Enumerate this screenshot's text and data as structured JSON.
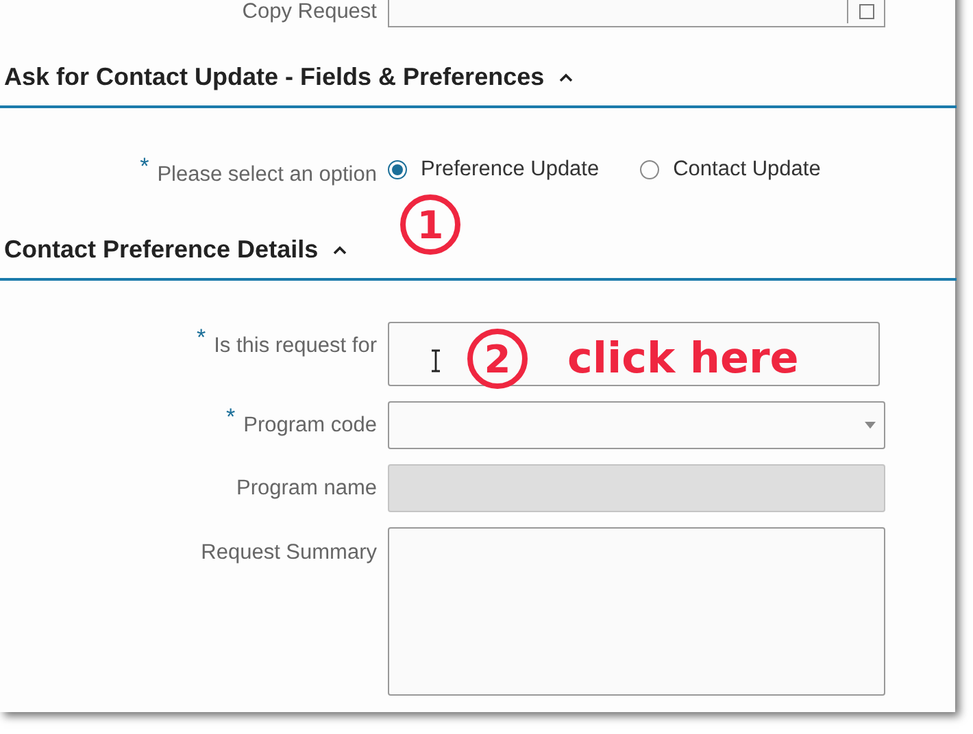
{
  "top_field": {
    "label": "Copy Request"
  },
  "sections": [
    {
      "title": "Ask for Contact Update - Fields & Preferences",
      "expanded": true,
      "fields": [
        {
          "kind": "radio",
          "label": "Please select an option",
          "required_mark": "*",
          "options": [
            {
              "label": "Preference Update",
              "selected": true
            },
            {
              "label": "Contact Update",
              "selected": false
            }
          ]
        }
      ]
    },
    {
      "title": "Contact Preference Details",
      "expanded": true,
      "fields": [
        {
          "kind": "text",
          "label": "Is this request for",
          "required_mark": "*",
          "disabled": false
        },
        {
          "kind": "dropdown",
          "label": "Program code",
          "required_mark": "*",
          "disabled": false
        },
        {
          "kind": "text",
          "label": "Program name",
          "disabled": true
        },
        {
          "kind": "textarea",
          "label": "Request Summary",
          "disabled": false
        }
      ]
    }
  ],
  "annotations": [
    {
      "number": "1"
    },
    {
      "number": "2",
      "text": "click here"
    }
  ]
}
